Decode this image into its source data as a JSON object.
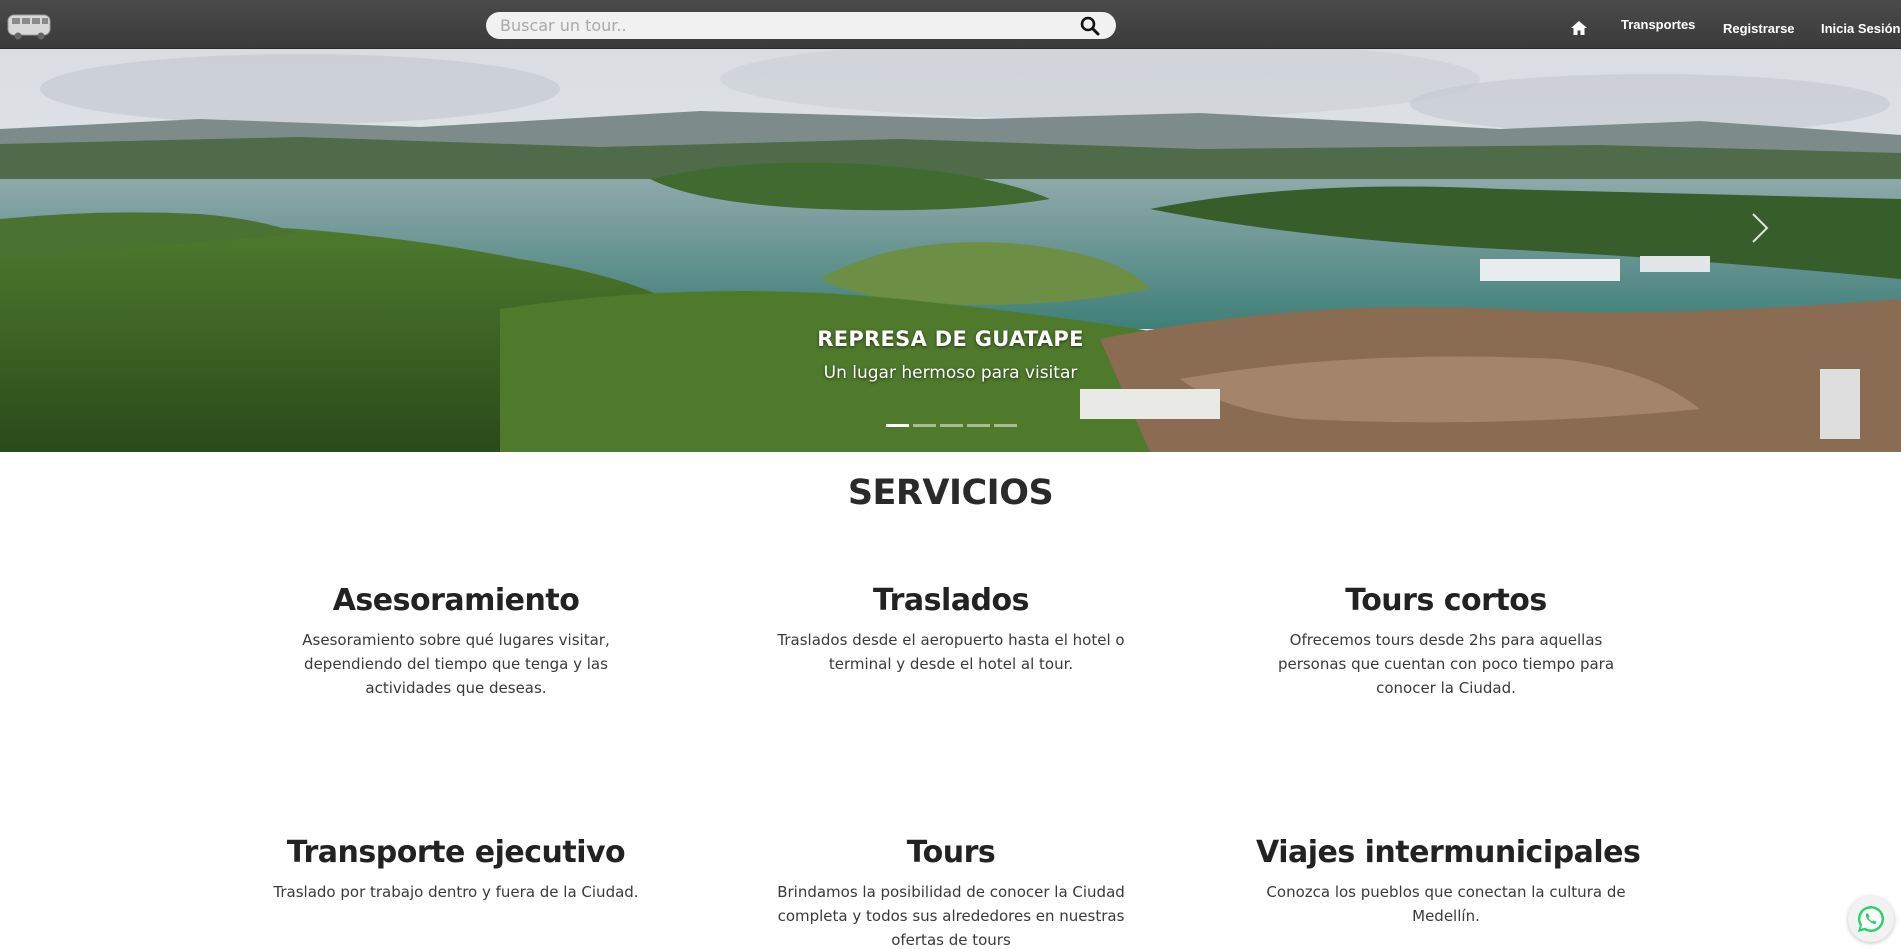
{
  "navbar": {
    "search_placeholder": "Buscar un tour..",
    "links": {
      "transportes": "Transportes",
      "registrarse": "Registrarse",
      "login": "Inicia Sesión"
    }
  },
  "hero": {
    "title": "REPRESA DE GUATAPE",
    "subtitle": "Un lugar hermoso para visitar",
    "slide_count": 5,
    "active_slide": 1
  },
  "services": {
    "heading": "SERVICIOS",
    "items": [
      {
        "title": "Asesoramiento",
        "text": "Asesoramiento sobre qué lugares visitar, dependiendo del tiempo que tenga y las actividades que deseas."
      },
      {
        "title": "Traslados",
        "text": "Traslados desde el aeropuerto hasta el hotel o terminal y desde el hotel al tour."
      },
      {
        "title": "Tours cortos",
        "text": "Ofrecemos tours desde 2hs para aquellas personas que cuentan con poco tiempo para conocer la Ciudad."
      },
      {
        "title": "Transporte ejecutivo",
        "text": "Traslado por trabajo dentro y fuera de la Ciudad."
      },
      {
        "title": "Tours",
        "text": "Brindamos la posibilidad de conocer la Ciudad completa y todos sus alrededores en nuestras ofertas de tours"
      },
      {
        "title": "Viajes intermunicipales",
        "text": "Conozca los pueblos que conectan la cultura de Medellín."
      }
    ]
  },
  "colors": {
    "navbar": "#434343",
    "text_dark": "#222222",
    "whatsapp_green": "#25d366"
  },
  "icons": {
    "logo": "van-logo-icon",
    "search": "search-icon",
    "home": "home-icon",
    "next": "chevron-right-icon",
    "chat": "whatsapp-icon"
  }
}
